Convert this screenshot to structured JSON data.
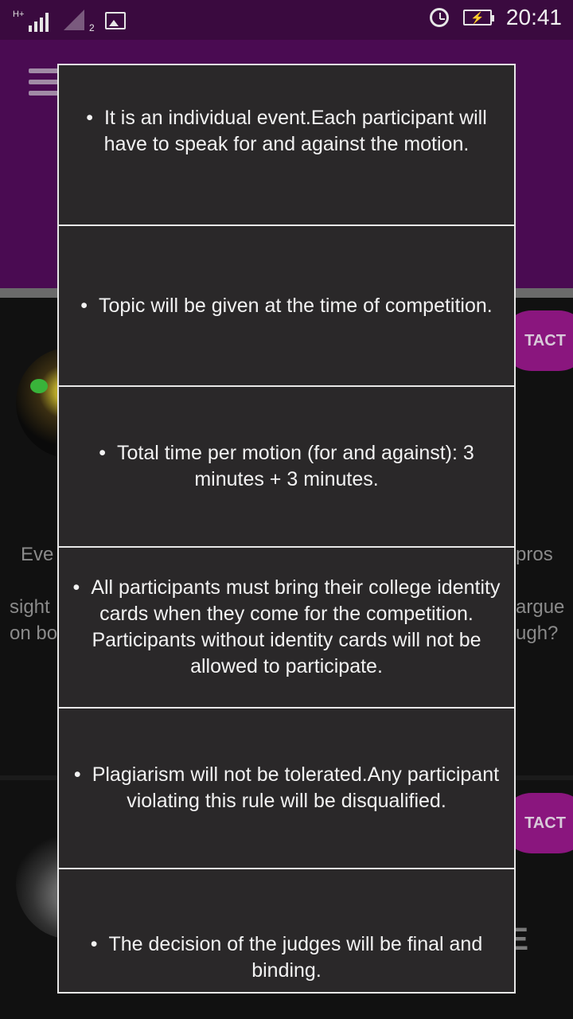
{
  "status_bar": {
    "network_label": "H+",
    "sim_number": "2",
    "time": "20:41",
    "icons": [
      "signal-icon",
      "sim-signal-icon",
      "gallery-icon",
      "alarm-icon",
      "battery-charging-icon"
    ]
  },
  "header": {
    "color": "#4a0b52"
  },
  "background": {
    "contact_label": "TACT",
    "text_left_1": "Eve",
    "text_left_2": "sight",
    "text_left_3": "on bo",
    "text_right_1": "pros",
    "text_right_2": "argue",
    "text_right_3": "ugh?",
    "trailing_letter": "E"
  },
  "rules": [
    "It is an individual event.Each participant will have to speak for and against the motion.",
    "Topic will be given at the time of competition.",
    "Total time per motion (for and against): 3 minutes + 3 minutes.",
    "All participants must bring their college identity cards when they come for the competition. Participants without identity cards will not be allowed to participate.",
    "Plagiarism will not be tolerated.Any participant violating this rule will be disqualified.",
    "The decision of the judges will be final and binding."
  ],
  "bullet": "•"
}
